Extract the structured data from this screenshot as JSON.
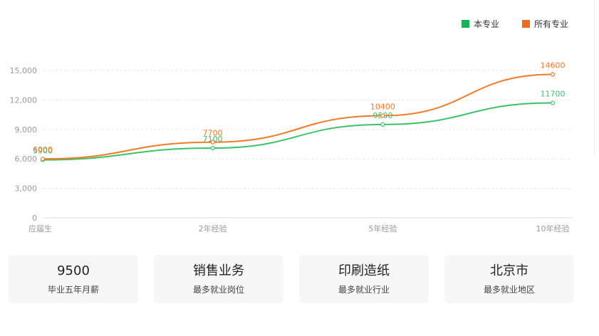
{
  "chart_data": {
    "type": "line",
    "categories": [
      "应届生",
      "2年经验",
      "5年经验",
      "10年经验"
    ],
    "series": [
      {
        "name": "本专业",
        "values": [
          5900,
          7100,
          9500,
          11700
        ],
        "color": "#3cc26a",
        "legend_color": "#16b35a"
      },
      {
        "name": "所有专业",
        "values": [
          6000,
          7700,
          10400,
          14600
        ],
        "color": "#f37a26",
        "legend_color": "#f26a1b"
      }
    ],
    "yticks": [
      0,
      3000,
      6000,
      9000,
      12000,
      15000
    ],
    "ytick_labels": [
      "0",
      "3,000",
      "6,000",
      "9,000",
      "12,000",
      "15,000"
    ],
    "ylim": [
      0,
      15000
    ],
    "legend_position": "top-right",
    "grid": "horizontal-dashed"
  },
  "cards": [
    {
      "value": "9500",
      "label": "毕业五年月薪"
    },
    {
      "value": "销售业务",
      "label": "最多就业岗位"
    },
    {
      "value": "印刷造纸",
      "label": "最多就业行业"
    },
    {
      "value": "北京市",
      "label": "最多就业地区"
    }
  ]
}
